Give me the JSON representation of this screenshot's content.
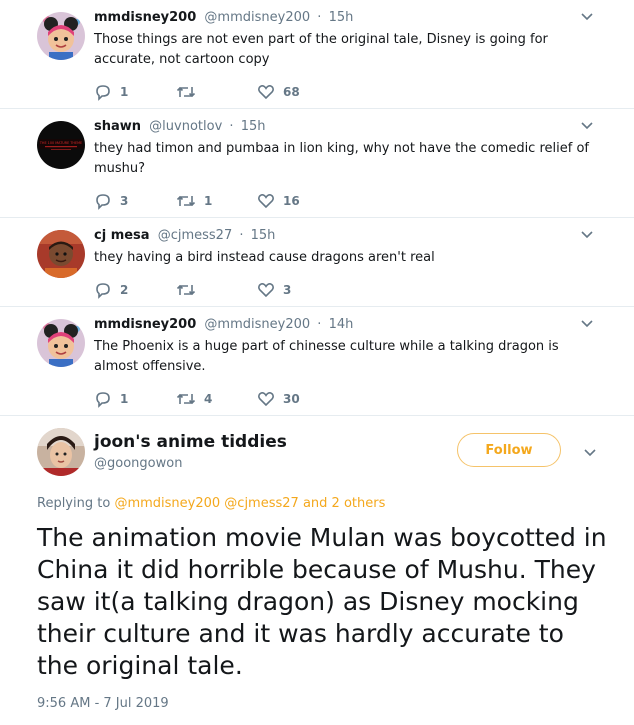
{
  "replies": [
    {
      "name": "mmdisney200",
      "handle": "@mmdisney200",
      "time": "15h",
      "text": "Those things are not even part of the original tale, Disney is going for accurate, not cartoon copy",
      "replies": "1",
      "retweets": "",
      "likes": "68"
    },
    {
      "name": "shawn",
      "handle": "@luvnotlov",
      "time": "15h",
      "text": "they had timon and pumbaa in lion king, why not have the comedic relief of mushu?",
      "replies": "3",
      "retweets": "1",
      "likes": "16"
    },
    {
      "name": "cj mesa",
      "handle": "@cjmess27",
      "time": "15h",
      "text": "they having a bird instead cause dragons aren't real",
      "replies": "2",
      "retweets": "",
      "likes": "3"
    },
    {
      "name": "mmdisney200",
      "handle": "@mmdisney200",
      "time": "14h",
      "text": "The Phoenix is a huge part of chinesse culture while a talking dragon is almost offensive.",
      "replies": "1",
      "retweets": "4",
      "likes": "30"
    }
  ],
  "main": {
    "name": "joon's anime tiddies",
    "handle": "@goongowon",
    "follow_label": "Follow",
    "replying_prefix": "Replying to",
    "replying_user1": "@mmdisney200",
    "replying_user2": "@cjmess27",
    "replying_suffix": "and 2 others",
    "text": "The animation movie Mulan was boycotted in China it did horrible because of Mushu. They saw it(a talking dragon) as Disney mocking their culture and it was hardly accurate to the original tale.",
    "timestamp": "9:56 AM - 7 Jul 2019",
    "avatar2_banner": "THE 100 MATURE THEME"
  },
  "colors": {
    "accent": "#f4a81d",
    "muted": "#657786",
    "text": "#14171a"
  }
}
